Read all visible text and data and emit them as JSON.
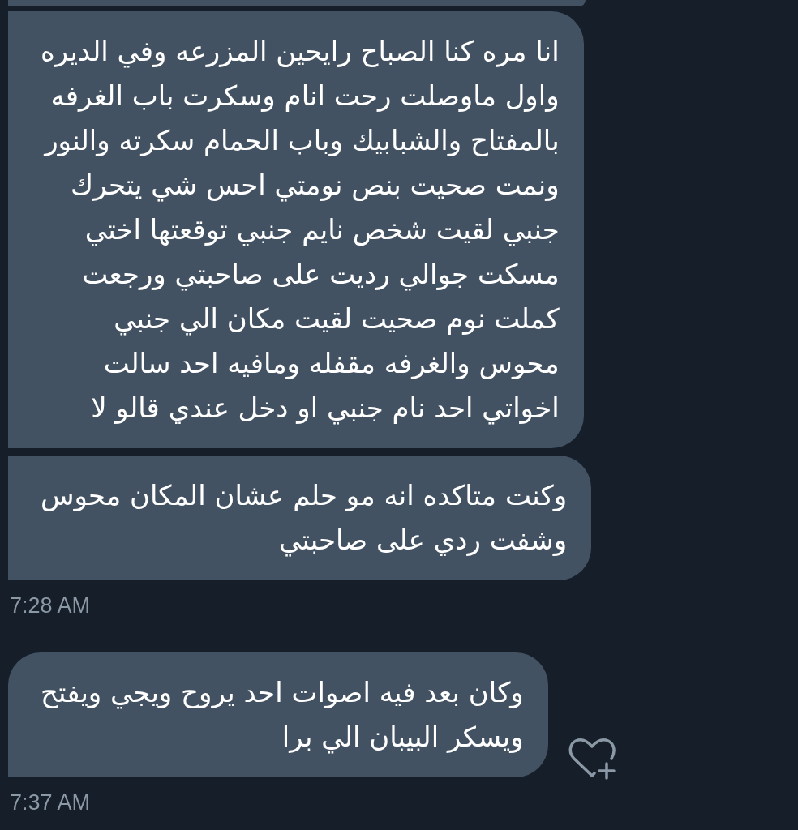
{
  "thread": [
    {
      "kind": "clipped_bubble"
    },
    {
      "kind": "message",
      "group_start": false,
      "react_button": false,
      "text": "انا مره كنا الصباح رايحين المزرعه وفي الديره\nواول ماوصلت رحت انام وسكرت باب الغرفه\nبالمفتاح والشبابيك وباب الحمام سكرته والنور\nونمت صحيت بنص نومتي احس شي يتحرك\nجنبي لقيت شخص نايم جنبي توقعتها اختي\nمسكت جوالي رديت على صاحبتي ورجعت\nكملت نوم صحيت لقيت مكان الي جنبي\nمحوس والغرفه مقفله ومافيه احد سالت\nاخواتي احد نام جنبي او دخل عندي قالو لا"
    },
    {
      "kind": "message",
      "group_start": false,
      "react_button": false,
      "text": "وكنت متاكده انه مو حلم عشان المكان محوس\nوشفت ردي على صاحبتي"
    },
    {
      "kind": "time",
      "text": "7:28 AM"
    },
    {
      "kind": "message",
      "group_start": true,
      "react_button": true,
      "text": "وكان بعد فيه اصوات احد يروح ويجي ويفتح\nويسكر البيبان الي برا"
    },
    {
      "kind": "time",
      "text": "7:37 AM"
    }
  ]
}
